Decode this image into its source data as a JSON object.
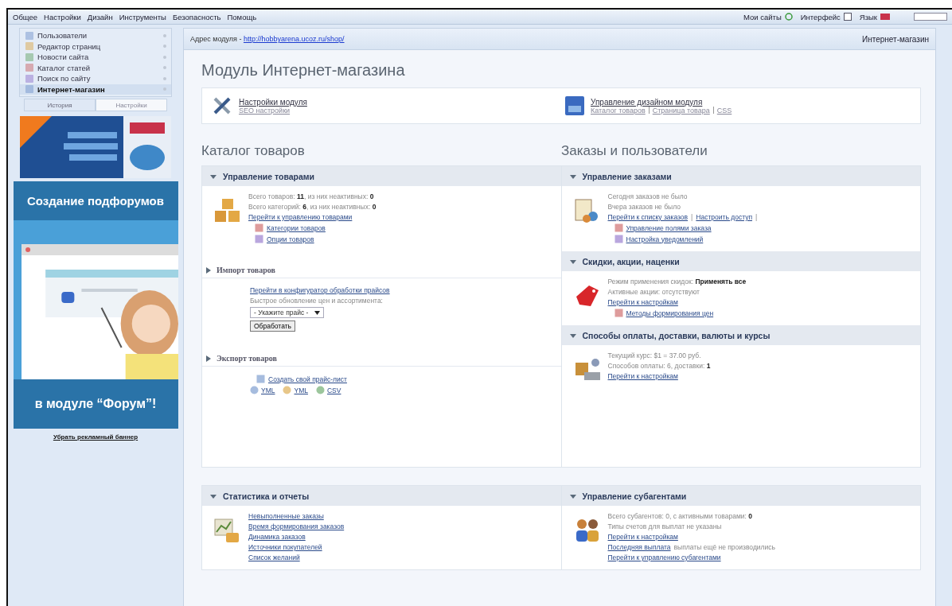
{
  "top_menu": [
    {
      "label": "Общее"
    },
    {
      "label": "Настройки"
    },
    {
      "label": "Дизайн"
    },
    {
      "label": "Инструменты"
    },
    {
      "label": "Безопасность"
    },
    {
      "label": "Помощь"
    }
  ],
  "top_right": [
    {
      "label": "Мои сайты"
    },
    {
      "label": "Интерфейс"
    },
    {
      "label": "Язык"
    }
  ],
  "sidebar": {
    "items": [
      {
        "label": "Пользователи",
        "selected": false
      },
      {
        "label": "Редактор страниц",
        "selected": false
      },
      {
        "label": "Новости сайта",
        "selected": false
      },
      {
        "label": "Каталог статей",
        "selected": false
      },
      {
        "label": "Поиск по сайту",
        "selected": false
      },
      {
        "label": "Интернет-магазин",
        "selected": true
      }
    ],
    "tabs": [
      {
        "label": "История",
        "selected": true
      },
      {
        "label": "Настройки",
        "selected": false
      }
    ],
    "banner": {
      "heading": "Создание подфорумов",
      "footer": "в модуле “Форум”!"
    },
    "banner_link": "Убрать рекламный баннер"
  },
  "address": {
    "label": "Адрес модуля - ",
    "url": "http://hobbyarena.ucoz.ru/shop/"
  },
  "module_name": "Интернет-магазин",
  "title": "Модуль Интернет-магазина",
  "quick_links": [
    {
      "title": "Настройки модуля",
      "links": [
        "SEO настройки"
      ]
    },
    {
      "title": "Управление дизайном модуля",
      "links": [
        "Каталог товаров",
        "Страница товара",
        "CSS"
      ]
    }
  ],
  "catalog": {
    "headings": [
      "Каталог товаров",
      "Заказы и пользователи"
    ],
    "columns": [
      [
        {
          "kind": "section",
          "title": "Управление товарами",
          "expanded": true,
          "lines": [
            {
              "kind": "text",
              "text": "Всего товаров: **11**, из них неактивных: **0**"
            },
            {
              "kind": "text",
              "text": "Всего категорий: **6**, из них неактивных: **0**"
            },
            {
              "kind": "link",
              "text": "Перейти к управлению товарами"
            },
            {
              "kind": "sublink",
              "text": "Категории товаров"
            },
            {
              "kind": "sublink",
              "text": "Опции товаров"
            }
          ]
        },
        {
          "kind": "subsection",
          "title": "Импорт товаров",
          "expanded": false,
          "lines": [
            {
              "kind": "link",
              "text": "Перейти в конфигуратор обработки прайсов"
            },
            {
              "kind": "text",
              "text": "Быстрое обновление цен и ассортимента:"
            },
            {
              "kind": "select",
              "text": "- Укажите прайс -"
            },
            {
              "kind": "button",
              "text": "Обработать"
            }
          ]
        },
        {
          "kind": "subsection",
          "title": "Экспорт товаров",
          "expanded": false,
          "lines": [
            {
              "kind": "sublink",
              "text": "Создать свой прайс-лист"
            },
            {
              "kind": "row",
              "parts": [
                {
                  "kind": "iconlink",
                  "text": "YML"
                },
                {
                  "kind": "iconlink",
                  "text": "YML"
                },
                {
                  "kind": "iconlink",
                  "text": "CSV"
                }
              ]
            }
          ]
        }
      ],
      [
        {
          "kind": "section",
          "title": "Управление заказами",
          "expanded": true,
          "lines": [
            {
              "kind": "text",
              "text": "Сегодня заказов не было"
            },
            {
              "kind": "text",
              "text": "Вчера заказов не было"
            },
            {
              "kind": "row",
              "parts": [
                {
                  "kind": "link",
                  "text": "Перейти к списку заказов"
                },
                {
                  "kind": "text",
                  "text": "|"
                },
                {
                  "kind": "link",
                  "text": "Настроить доступ"
                },
                {
                  "kind": "text",
                  "text": "|"
                }
              ]
            },
            {
              "kind": "sublink",
              "text": "Управление полями заказа"
            },
            {
              "kind": "sublink",
              "text": "Настройка уведомлений"
            }
          ]
        },
        {
          "kind": "section",
          "title": "Скидки, акции, наценки",
          "expanded": true,
          "lines": [
            {
              "kind": "text",
              "text": "Режим применения скидок: **Применять все**"
            },
            {
              "kind": "text",
              "text": "Активные акции: отсутствуют"
            },
            {
              "kind": "link",
              "text": "Перейти к настройкам"
            },
            {
              "kind": "sublink",
              "text": "Методы формирования цен"
            }
          ]
        },
        {
          "kind": "section",
          "title": "Способы оплаты, доставки, валюты и курсы",
          "expanded": true,
          "lines": [
            {
              "kind": "text",
              "text": "Текущий курс: $1 = 37.00 руб."
            },
            {
              "kind": "text",
              "text": "Способов оплаты: 6, доставки: **1**"
            },
            {
              "kind": "link",
              "text": "Перейти к настройкам"
            }
          ]
        }
      ]
    ]
  },
  "bottom": {
    "columns": [
      [
        {
          "kind": "section",
          "title": "Статистика и отчеты",
          "expanded": true,
          "lines": [
            {
              "kind": "link",
              "text": "Невыполненные заказы"
            },
            {
              "kind": "link",
              "text": "Время формирования заказов"
            },
            {
              "kind": "link",
              "text": "Динамика заказов"
            },
            {
              "kind": "link",
              "text": "Источники покупателей"
            },
            {
              "kind": "link",
              "text": "Список желаний"
            }
          ]
        }
      ],
      [
        {
          "kind": "section",
          "title": "Управление субагентами",
          "expanded": true,
          "lines": [
            {
              "kind": "text",
              "text": "Всего субагентов: 0, с активными товарами: **0**"
            },
            {
              "kind": "text",
              "text": "Типы счетов для выплат не указаны"
            },
            {
              "kind": "link",
              "text": "Перейти к настройкам"
            },
            {
              "kind": "row",
              "parts": [
                {
                  "kind": "link",
                  "text": "Последняя выплата"
                },
                {
                  "kind": "text",
                  "text": "выплаты ещё не производились"
                }
              ]
            },
            {
              "kind": "link",
              "text": "Перейти к управлению субагентами"
            }
          ]
        }
      ]
    ]
  }
}
